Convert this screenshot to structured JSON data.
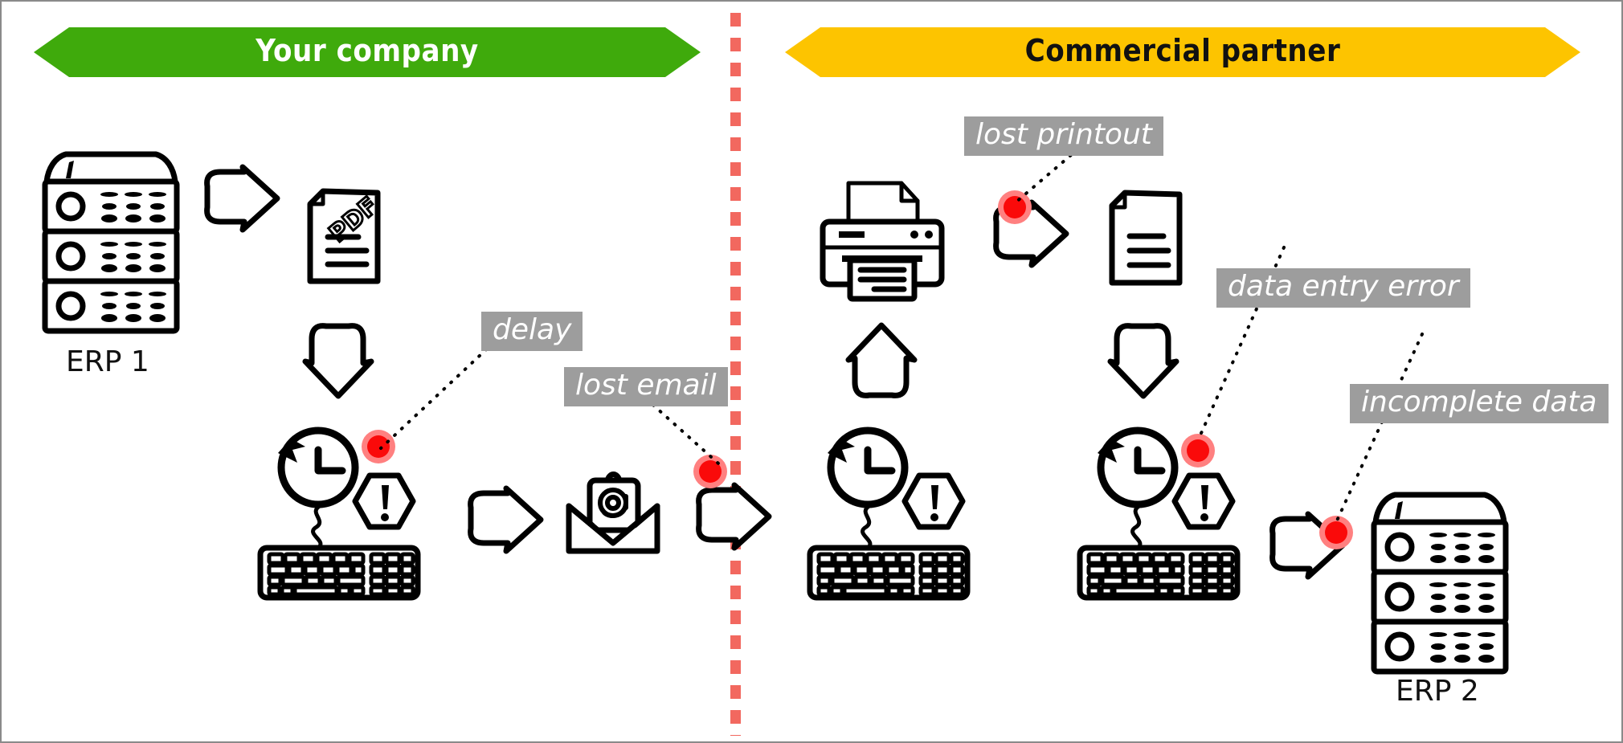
{
  "diagram": {
    "title_left": "Your company",
    "title_right": "Commercial partner",
    "left_banner_color": "#3faa0c",
    "right_banner_color": "#fdc400",
    "divider_color": "#f2685f",
    "defect_color": "#fa0a0a",
    "callout_bg": "#9d9d9d"
  },
  "left_lane": {
    "banner_label": "Your company",
    "erp_label": "ERP 1",
    "nodes": [
      {
        "name": "erp-1-server",
        "icon": "server-icon"
      },
      {
        "name": "arrow-erp-to-pdf",
        "icon": "arrow-right-icon"
      },
      {
        "name": "pdf-document",
        "icon": "pdf-document-icon",
        "text": "PDF"
      },
      {
        "name": "arrow-pdf-to-workstation",
        "icon": "arrow-down-icon"
      },
      {
        "name": "workstation-manual-entry",
        "icon": "clock-keyboard-warning-icon"
      },
      {
        "name": "arrow-workstation-to-email",
        "icon": "arrow-right-icon"
      },
      {
        "name": "email-envelope",
        "icon": "email-at-icon"
      },
      {
        "name": "arrow-email-to-partner",
        "icon": "arrow-right-icon"
      }
    ],
    "callouts": [
      {
        "name": "callout-delay",
        "label": "delay"
      },
      {
        "name": "callout-lost-email",
        "label": "lost email"
      }
    ]
  },
  "right_lane": {
    "banner_label": "Commercial partner",
    "erp_label": "ERP 2",
    "nodes": [
      {
        "name": "printer",
        "icon": "printer-icon"
      },
      {
        "name": "arrow-inbound-to-printer",
        "icon": "arrow-up-icon"
      },
      {
        "name": "workstation-receive",
        "icon": "clock-keyboard-warning-icon"
      },
      {
        "name": "arrow-printer-to-document",
        "icon": "arrow-right-icon"
      },
      {
        "name": "printed-document",
        "icon": "document-icon"
      },
      {
        "name": "arrow-document-to-workstation",
        "icon": "arrow-down-icon"
      },
      {
        "name": "workstation-data-entry",
        "icon": "clock-keyboard-warning-icon"
      },
      {
        "name": "arrow-workstation-to-erp2",
        "icon": "arrow-right-icon"
      },
      {
        "name": "erp-2-server",
        "icon": "server-icon"
      }
    ],
    "callouts": [
      {
        "name": "callout-lost-printout",
        "label": "lost printout"
      },
      {
        "name": "callout-data-entry-error",
        "label": "data entry error"
      },
      {
        "name": "callout-incomplete-data",
        "label": "incomplete data"
      }
    ]
  },
  "callout_labels": {
    "delay": "delay",
    "lost_email": "lost email",
    "lost_printout": "lost printout",
    "data_entry_error": "data entry error",
    "incomplete_data": "incomplete data"
  },
  "captions": {
    "erp1": "ERP 1",
    "erp2": "ERP 2"
  }
}
